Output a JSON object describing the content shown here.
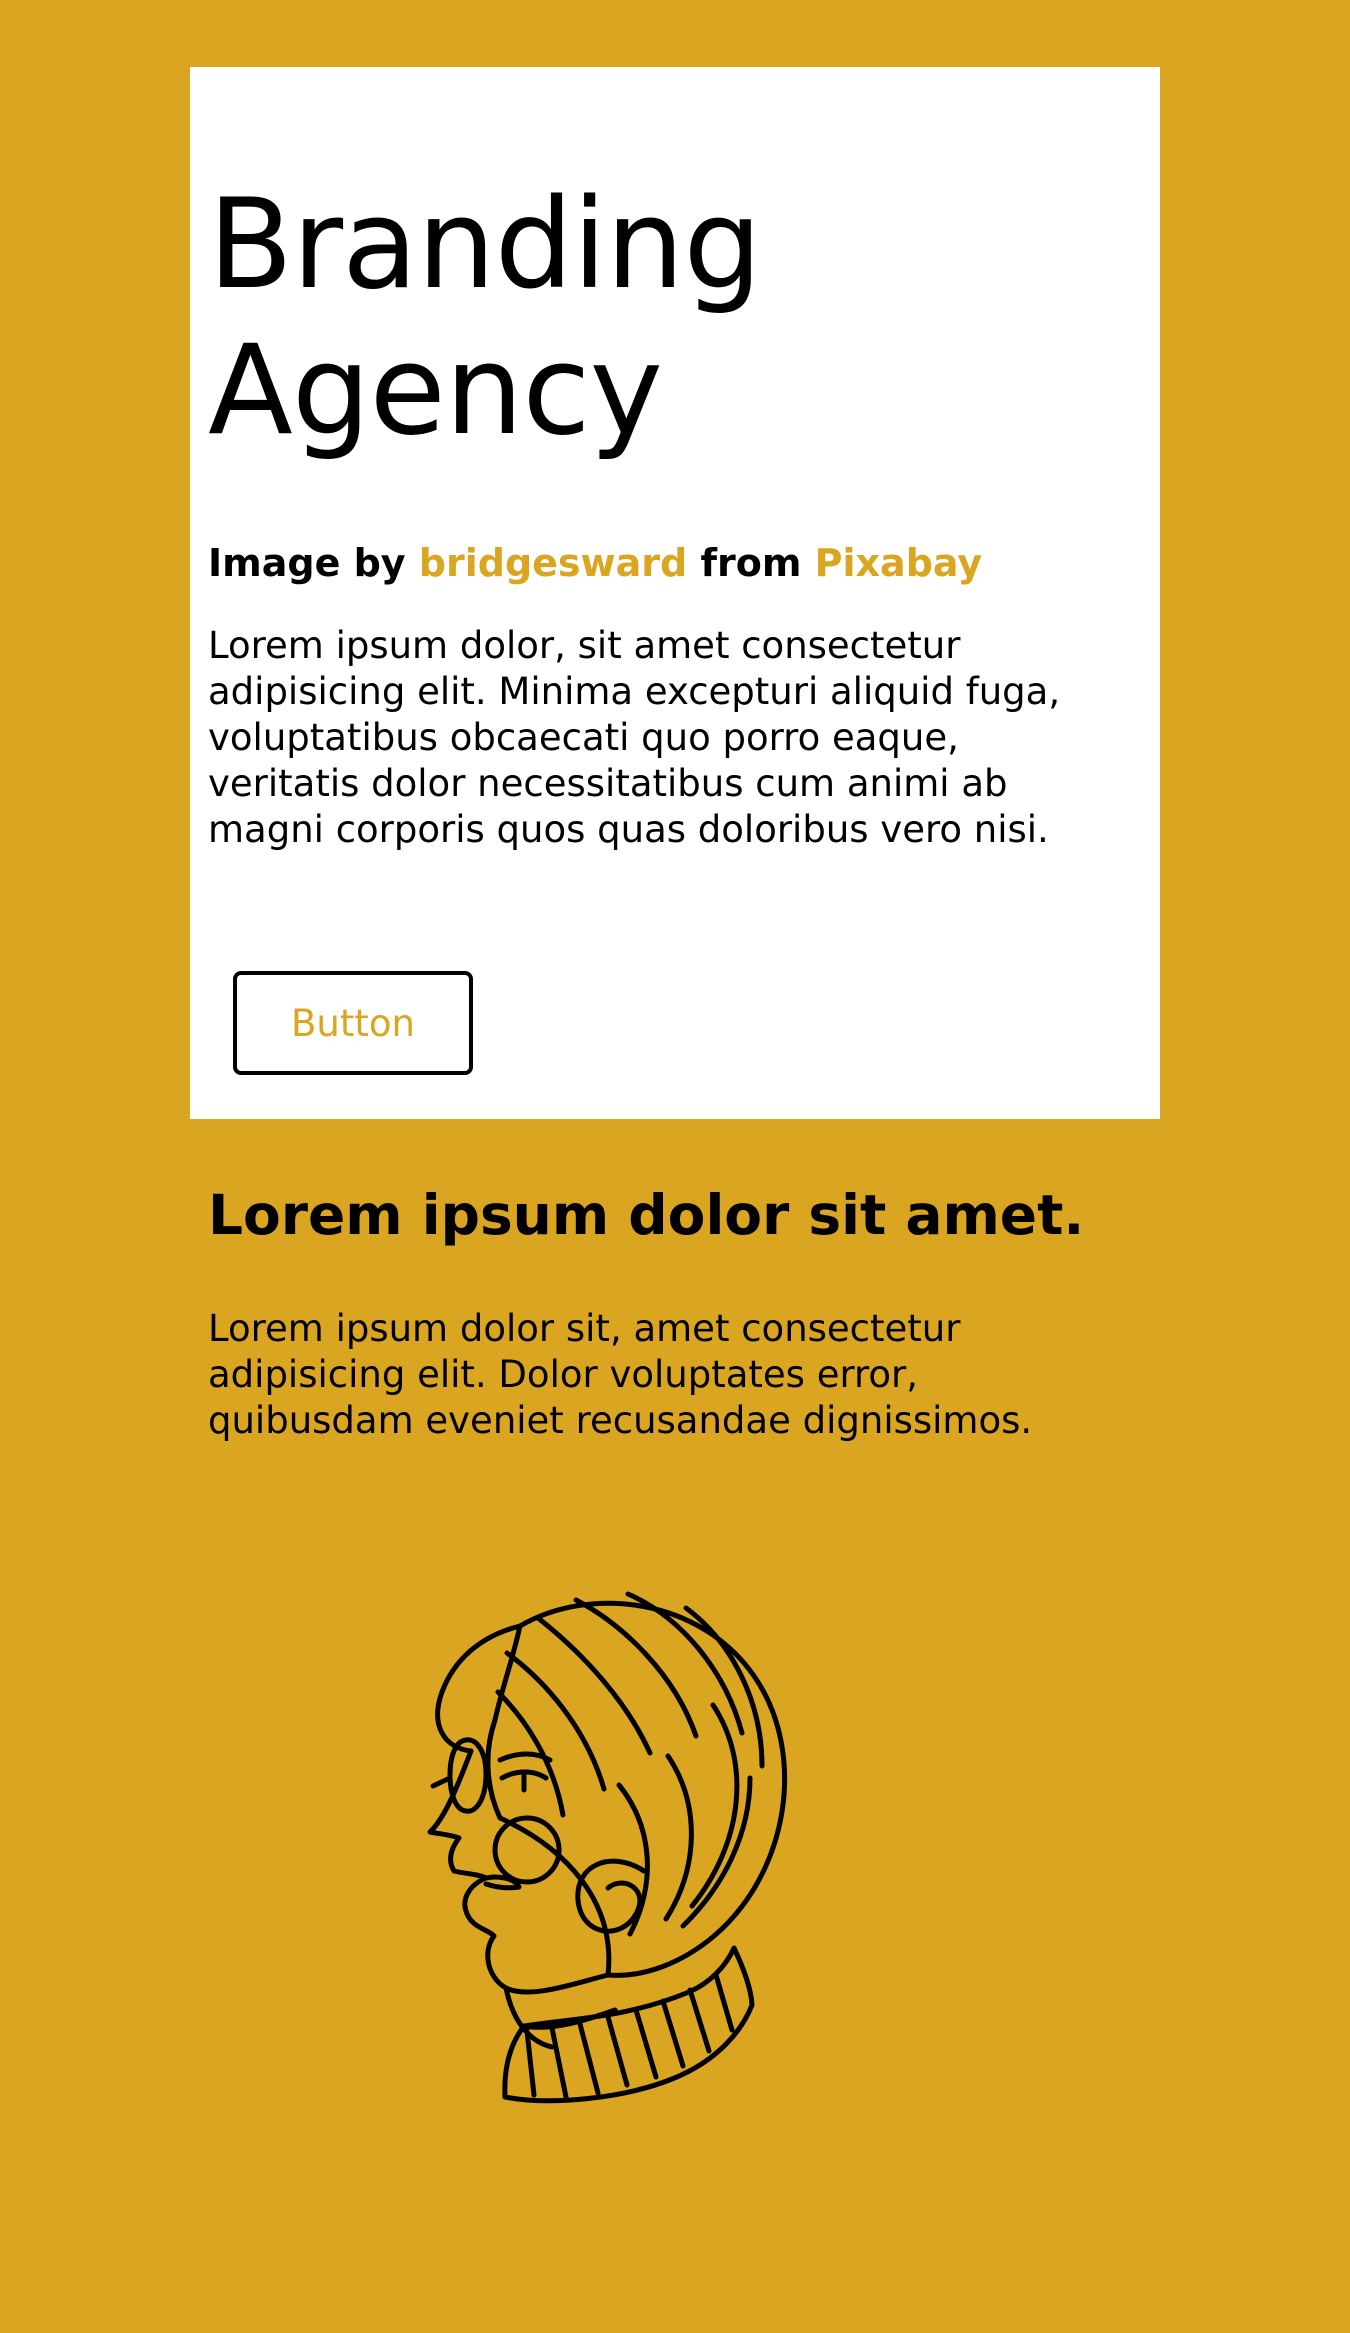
{
  "hero": {
    "title_line1": "Branding",
    "title_line2": "Agency",
    "credit": {
      "prefix": "Image by ",
      "author": "bridgesward",
      "middle": " from ",
      "source": "Pixabay"
    },
    "description": "Lorem ipsum dolor, sit amet consectetur adipisicing elit. Minima excepturi aliquid fuga, voluptatibus obcaecati quo porro eaque, veritatis dolor necessitatibus cum animi ab magni corporis quos quas doloribus vero nisi.",
    "button_label": "Button"
  },
  "section": {
    "title": "Lorem ipsum dolor sit amet.",
    "text": "Lorem ipsum dolor sit, amet consectetur adipisicing elit. Dolor voluptates error, quibusdam eveniet recusandae dignissimos."
  },
  "colors": {
    "background": "#daa520",
    "card": "#ffffff",
    "accent": "#daa520",
    "text": "#000000"
  },
  "illustration": {
    "icon": "woman-profile-line-art-icon"
  }
}
